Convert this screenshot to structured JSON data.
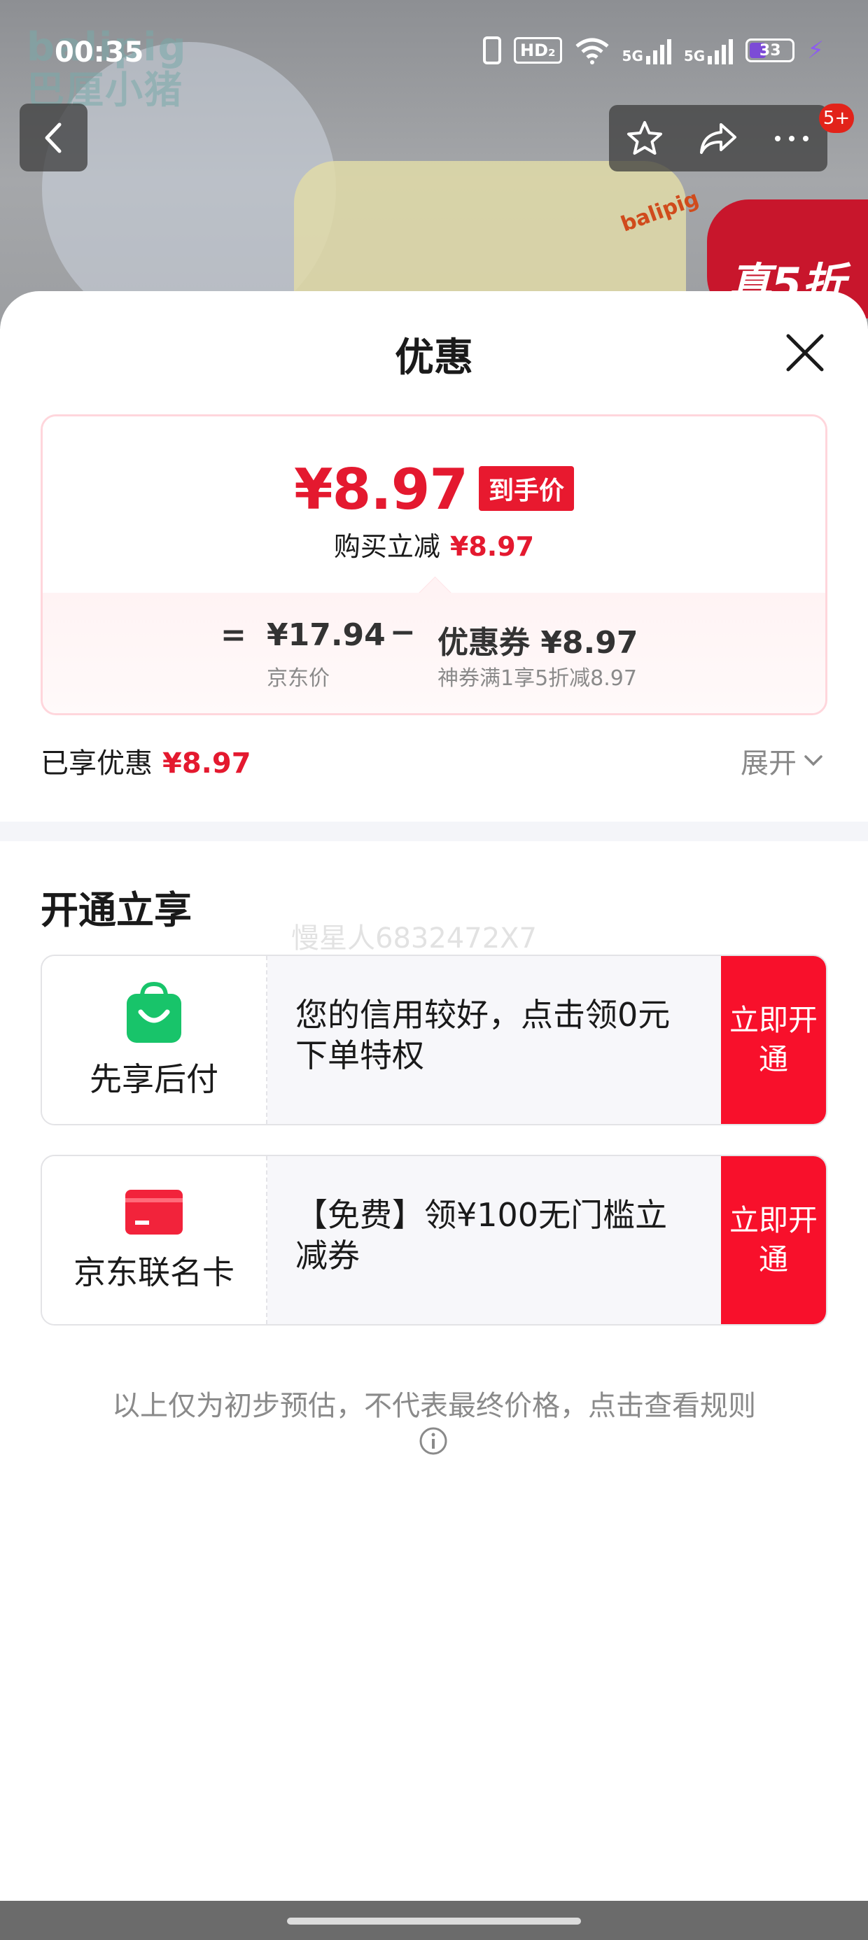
{
  "status_bar": {
    "time": "00:35",
    "hd": "HD₂",
    "sig1": "5G",
    "sig2": "5G",
    "battery": "33"
  },
  "background": {
    "brand_name": "balipig",
    "brand_sub": "巴厘小猪",
    "promo_tag": "真5折",
    "logo_small": "balipig"
  },
  "header_badge": "5+",
  "sheet": {
    "title": "优惠",
    "price_card": {
      "final_price": "¥8.97",
      "final_tag": "到手价",
      "instant_label": "购买立减",
      "instant_value": "¥8.97",
      "equals": "=",
      "minus": "−",
      "jd_price": "¥17.94",
      "jd_price_label": "京东价",
      "coupon": "优惠券 ¥8.97",
      "coupon_desc": "神券满1享5折减8.97"
    },
    "enjoyed_label": "已享优惠",
    "enjoyed_value": "¥8.97",
    "expand_label": "展开",
    "section_title": "开通立享",
    "watermark": "慢星人6832472X7",
    "offers": [
      {
        "name": "先享后付",
        "text": "您的信用较好，点击领0元下单特权",
        "button": "立即开通"
      },
      {
        "name": "京东联名卡",
        "text": "【免费】领¥100无门槛立减券",
        "button": "立即开通"
      }
    ],
    "disclaimer": "以上仅为初步预估，不代表最终价格，点击查看规则"
  },
  "colors": {
    "accent_red": "#e4192f",
    "button_red": "#f8102b",
    "green": "#18c46a"
  }
}
